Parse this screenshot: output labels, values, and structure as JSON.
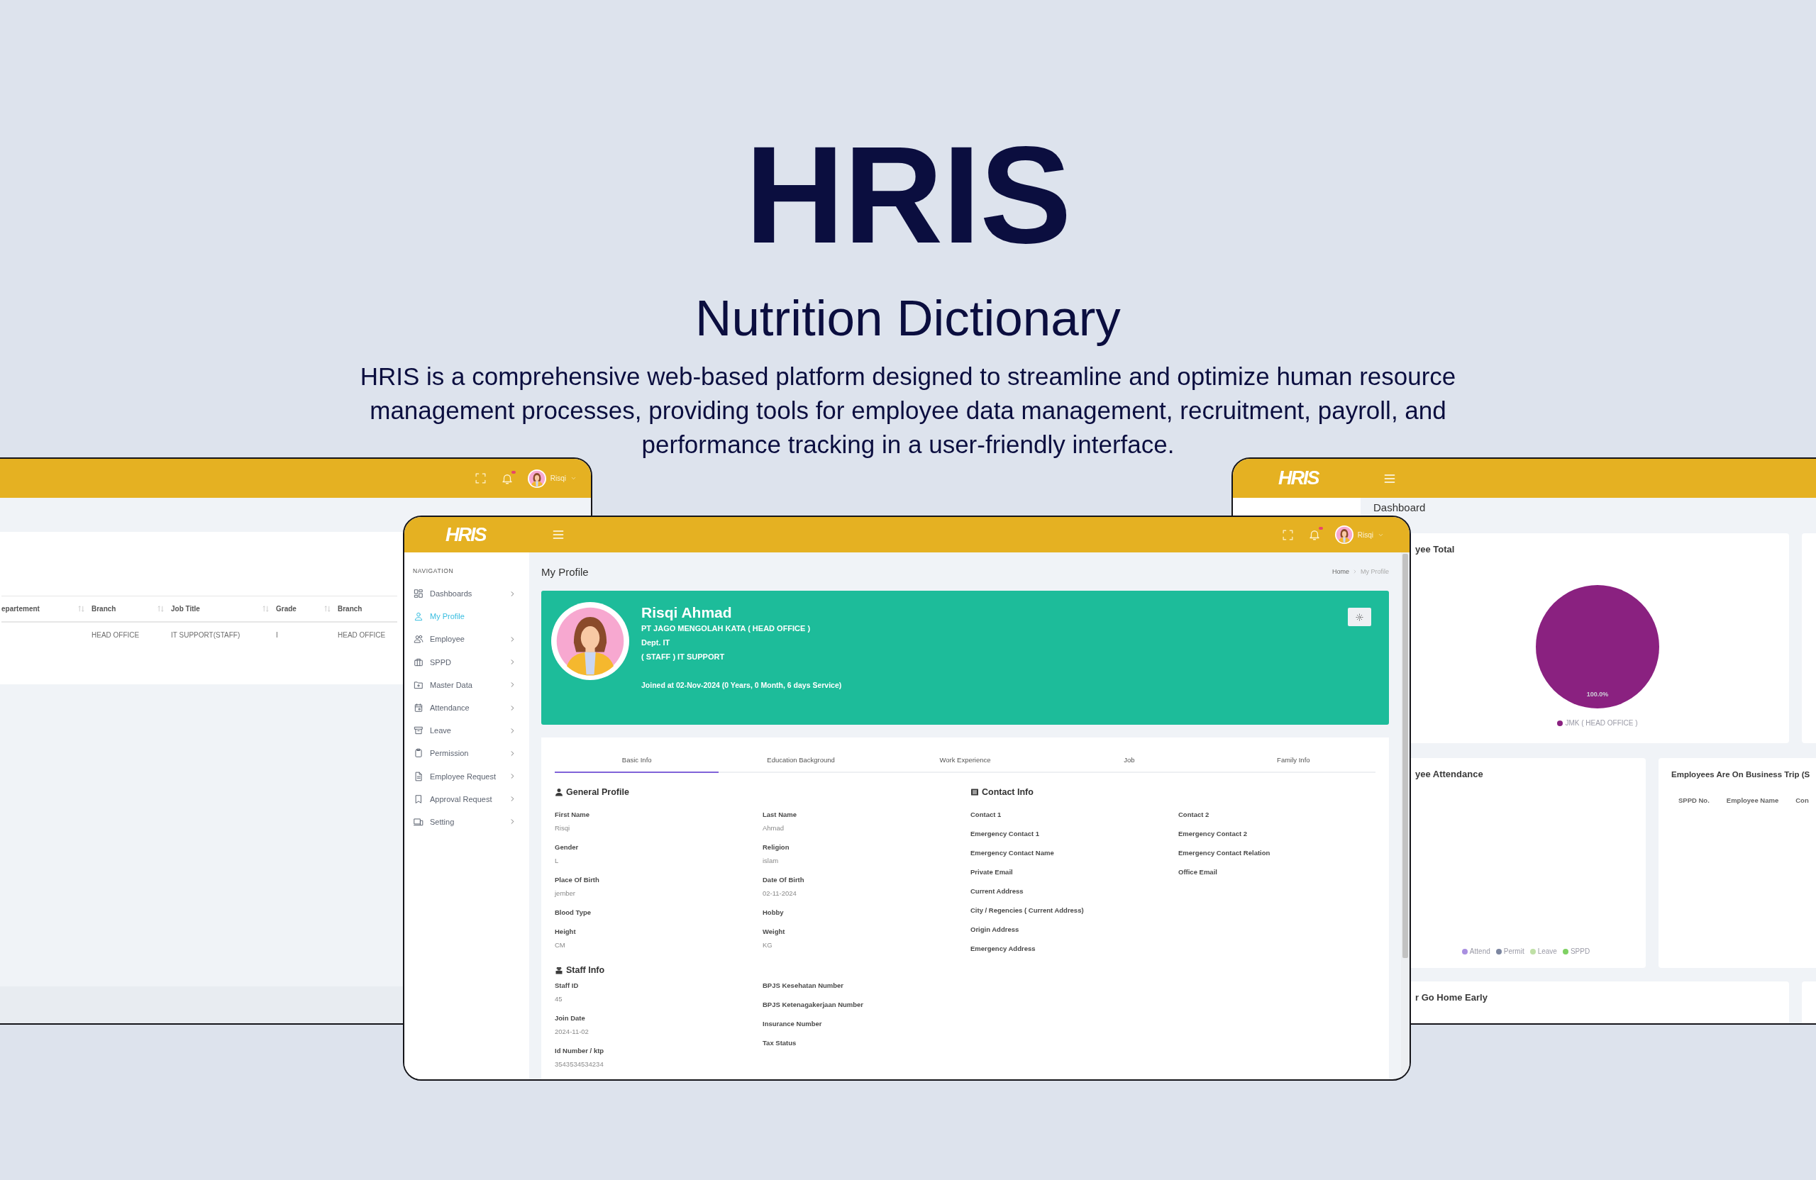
{
  "hero": {
    "title": "HRIS",
    "subtitle": "Nutrition Dictionary",
    "description": "HRIS is a comprehensive web-based platform designed to streamline and optimize human resource management processes, providing tools for employee data management, recruitment, payroll, and performance tracking in a user-friendly interface."
  },
  "employee_window": {
    "topbar": {
      "user": "Risqi",
      "notification": true
    },
    "table": {
      "columns": [
        {
          "label": "epartement",
          "sortable": true
        },
        {
          "label": "Branch",
          "sortable": true
        },
        {
          "label": "Job Title",
          "sortable": true
        },
        {
          "label": "Grade",
          "sortable": true
        },
        {
          "label": "Branch"
        }
      ],
      "rows": [
        {
          "cells": [
            null,
            "HEAD OFFICE",
            "IT SUPPORT(STAFF)",
            "I",
            "HEAD OFFICE"
          ]
        }
      ]
    }
  },
  "dashboard_window": {
    "topbar": {
      "logo": "HRIS"
    },
    "title": "Dashboard",
    "cards": [
      {
        "kind": "pie",
        "title": "yee Total",
        "slice_label": "100.0%",
        "legend": [
          {
            "label": "JMK ( HEAD OFFICE )",
            "color": "#8a2180"
          }
        ]
      },
      {
        "kind": "legend",
        "title": "yee Attendance",
        "legend": [
          {
            "label": "Attend",
            "color": "#a98fe0"
          },
          {
            "label": "Permit",
            "color": "#7c86a0"
          },
          {
            "label": "Leave",
            "color": "#bfe0a6"
          },
          {
            "label": "SPPD",
            "color": "#7fd163"
          }
        ]
      },
      {
        "kind": "table",
        "title": "Employees Are On Business Trip (S",
        "columns": [
          "SPPD No.",
          "Employee Name",
          "Con"
        ]
      },
      {
        "kind": "plain",
        "title": "r Go Home Early"
      }
    ]
  },
  "profile_window": {
    "topbar": {
      "logo": "HRIS",
      "user": "Risqi",
      "notification": true
    },
    "sidebar": {
      "heading": "NAVIGATION",
      "items": [
        {
          "label": "Dashboards",
          "kind": "grid",
          "selected": false,
          "expandable": true
        },
        {
          "label": "My Profile",
          "kind": "user",
          "selected": true,
          "expandable": false
        },
        {
          "label": "Employee",
          "kind": "users",
          "selected": false,
          "expandable": true
        },
        {
          "label": "SPPD",
          "kind": "briefcase",
          "selected": false,
          "expandable": true
        },
        {
          "label": "Master Data",
          "kind": "folder",
          "selected": false,
          "expandable": true
        },
        {
          "label": "Attendance",
          "kind": "calendar",
          "selected": false,
          "expandable": true
        },
        {
          "label": "Leave",
          "kind": "archive",
          "selected": false,
          "expandable": true
        },
        {
          "label": "Permission",
          "kind": "clipboard",
          "selected": false,
          "expandable": true
        },
        {
          "label": "Employee Request",
          "kind": "file",
          "selected": false,
          "expandable": true
        },
        {
          "label": "Approval Request",
          "kind": "bookmark",
          "selected": false,
          "expandable": true
        },
        {
          "label": "Setting",
          "kind": "devices",
          "selected": false,
          "expandable": true
        }
      ]
    },
    "page_title": "My Profile",
    "breadcrumb": [
      "Home",
      "My Profile"
    ],
    "profile": {
      "name": "Risqi Ahmad",
      "company": "PT JAGO MENGOLAH KATA ( HEAD OFFICE )",
      "department": "Dept. IT",
      "position": "( STAFF ) IT SUPPORT",
      "joined": "Joined at 02-Nov-2024 (0 Years, 0 Month, 6 days Service)"
    },
    "tabs": [
      {
        "label": "Basic Info",
        "selected": true
      },
      {
        "label": "Education Background",
        "selected": false
      },
      {
        "label": "Work Experience",
        "selected": false
      },
      {
        "label": "Job",
        "selected": false
      },
      {
        "label": "Family Info",
        "selected": false
      }
    ],
    "panels": [
      {
        "sections": [
          {
            "title": "General Profile",
            "kind": "person",
            "columns": [
              [
                {
                  "label": "First Name",
                  "value": "Risqi"
                },
                {
                  "label": "Gender",
                  "value": "L"
                },
                {
                  "label": "Place Of Birth",
                  "value": "jember"
                },
                {
                  "label": "Blood Type"
                },
                {
                  "label": "Height",
                  "value": "CM"
                }
              ],
              [
                {
                  "label": "Last Name",
                  "value": "Ahmad"
                },
                {
                  "label": "Religion",
                  "value": "islam"
                },
                {
                  "label": "Date Of Birth",
                  "value": "02-11-2024"
                },
                {
                  "label": "Hobby"
                },
                {
                  "label": "Weight",
                  "value": "KG"
                }
              ]
            ]
          },
          {
            "title": "Staff Info",
            "kind": "staff",
            "columns": [
              [
                {
                  "label": "Staff ID",
                  "value": "45"
                },
                {
                  "label": "Join Date",
                  "value": "2024-11-02"
                },
                {
                  "label": "Id Number / ktp",
                  "value": "3543534534234"
                }
              ],
              [
                {
                  "label": "BPJS Kesehatan Number"
                },
                {
                  "label": "BPJS Ketenagakerjaan Number"
                },
                {
                  "label": "Insurance Number"
                },
                {
                  "label": "Tax Status"
                }
              ]
            ]
          }
        ]
      },
      {
        "sections": [
          {
            "title": "Contact Info",
            "kind": "card",
            "columns": [
              [
                {
                  "label": "Contact 1"
                },
                {
                  "label": "Emergency Contact 1"
                },
                {
                  "label": "Emergency Contact Name"
                },
                {
                  "label": "Private Email"
                },
                {
                  "label": "Current Address"
                },
                {
                  "label": "City / Regencies ( Current Address)"
                },
                {
                  "label": "Origin Address"
                },
                {
                  "label": "Emergency Address"
                }
              ],
              [
                {
                  "label": "Contact 2"
                },
                {
                  "label": "Emergency Contact 2"
                },
                {
                  "label": "Emergency Contact Relation"
                },
                {
                  "label": "Office Email"
                }
              ]
            ]
          }
        ]
      }
    ]
  }
}
